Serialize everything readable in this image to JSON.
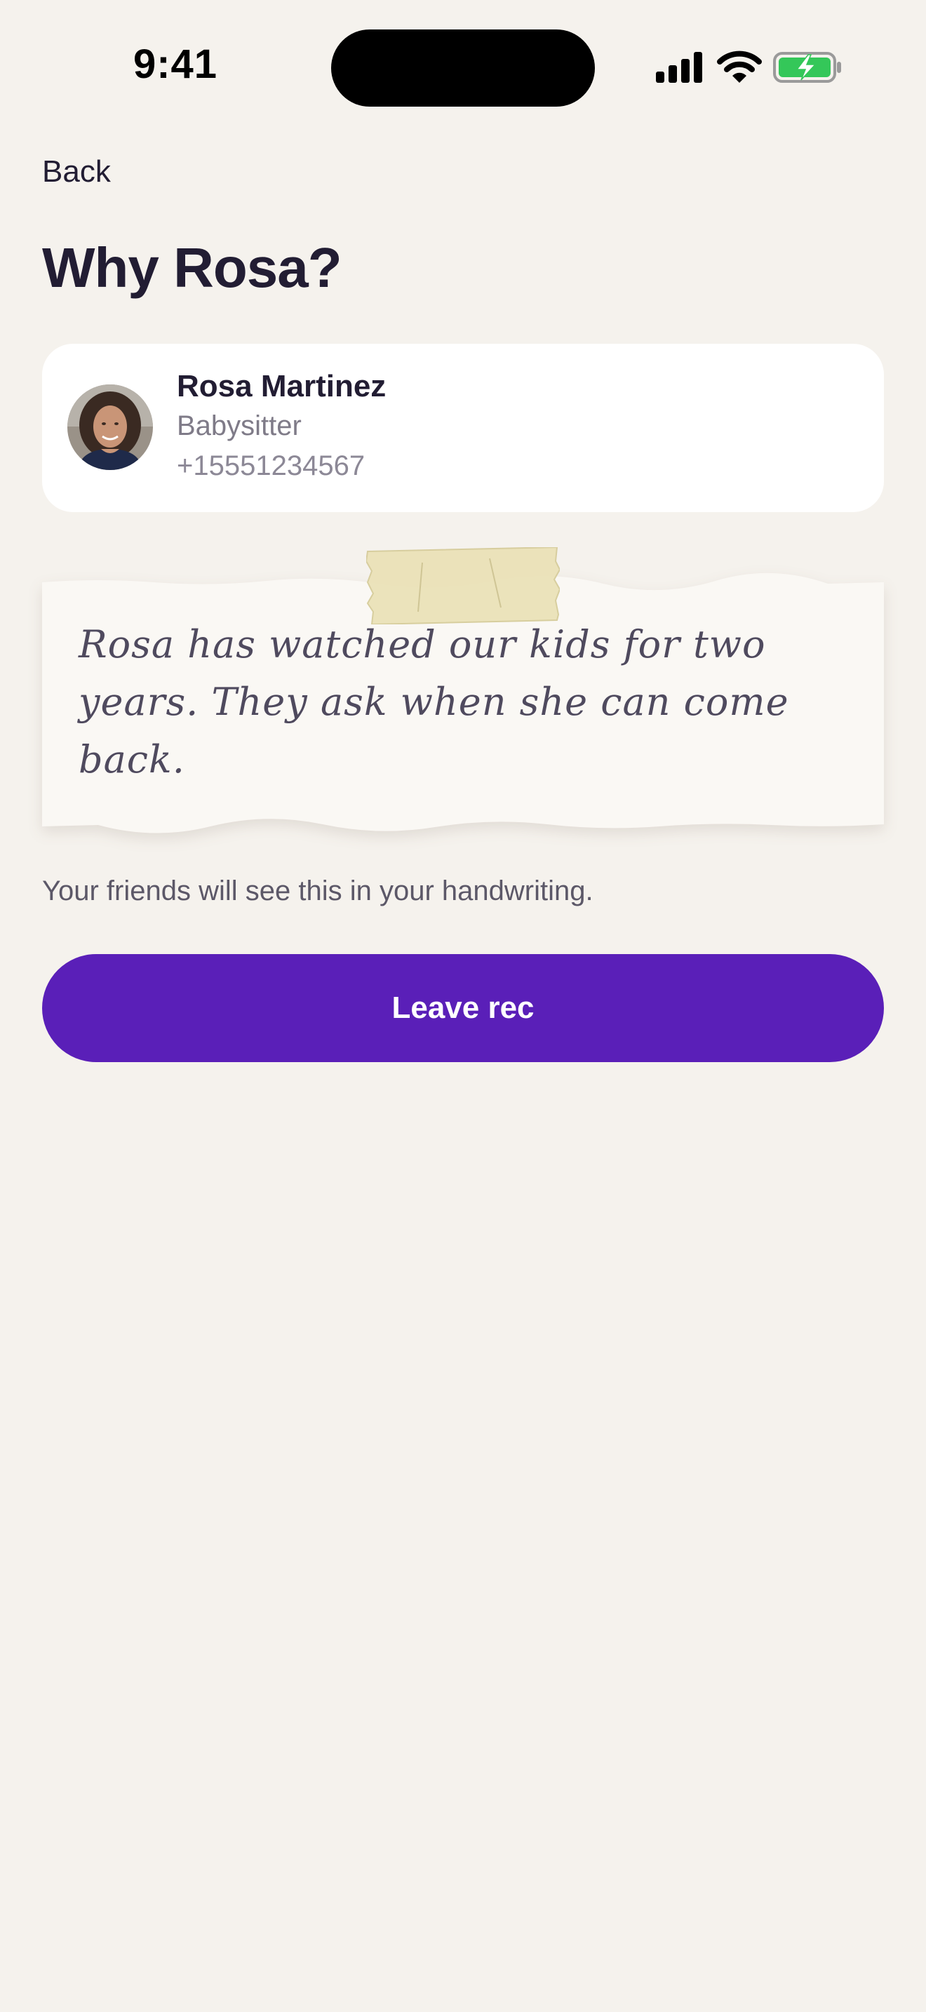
{
  "status_bar": {
    "time": "9:41",
    "icons": [
      "signal-icon",
      "wifi-icon",
      "battery-charging-icon"
    ],
    "battery_color": "#34c759"
  },
  "nav": {
    "back_label": "Back"
  },
  "page": {
    "title": "Why Rosa?"
  },
  "contact": {
    "name": "Rosa Martinez",
    "role": "Babysitter",
    "phone": "+15551234567"
  },
  "note": {
    "text": "Rosa has watched our kids for two years. They ask when she can come back."
  },
  "helper_text": "Your friends will see this in your handwriting.",
  "primary_action": {
    "label": "Leave rec",
    "color": "#5a1fb8"
  },
  "colors": {
    "background": "#f5f2ed",
    "paper": "#faf8f4",
    "tape": "#ebe2b8",
    "text_primary": "#221d33"
  }
}
